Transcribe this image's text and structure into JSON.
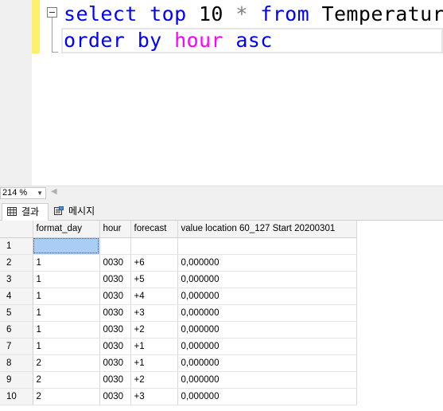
{
  "editor": {
    "lines": [
      [
        {
          "t": "select",
          "c": "kw"
        },
        {
          "t": " ",
          "c": "tx"
        },
        {
          "t": "top",
          "c": "kw"
        },
        {
          "t": " 10 ",
          "c": "tx"
        },
        {
          "t": "*",
          "c": "op"
        },
        {
          "t": " ",
          "c": "tx"
        },
        {
          "t": "from",
          "c": "kw"
        },
        {
          "t": " Temperature",
          "c": "tx"
        }
      ],
      [
        {
          "t": "order",
          "c": "kw"
        },
        {
          "t": " ",
          "c": "tx"
        },
        {
          "t": "by",
          "c": "kw"
        },
        {
          "t": " ",
          "c": "tx"
        },
        {
          "t": "hour",
          "c": "fn"
        },
        {
          "t": " ",
          "c": "tx"
        },
        {
          "t": "asc",
          "c": "kw"
        }
      ]
    ]
  },
  "zoom": {
    "value": "214 %"
  },
  "tabs": {
    "results": "결과",
    "messages": "메시지"
  },
  "grid": {
    "columns": [
      "format_day",
      "hour",
      "forecast",
      "value location 60_127 Start   20200301"
    ],
    "rows": [
      {
        "n": "1",
        "cells": [
          "",
          "",
          "",
          ""
        ]
      },
      {
        "n": "2",
        "cells": [
          "1",
          "0030",
          "+6",
          "0,000000"
        ]
      },
      {
        "n": "3",
        "cells": [
          "1",
          "0030",
          "+5",
          "0,000000"
        ]
      },
      {
        "n": "4",
        "cells": [
          "1",
          "0030",
          "+4",
          "0,000000"
        ]
      },
      {
        "n": "5",
        "cells": [
          "1",
          "0030",
          "+3",
          "0,000000"
        ]
      },
      {
        "n": "6",
        "cells": [
          "1",
          "0030",
          "+2",
          "0,000000"
        ]
      },
      {
        "n": "7",
        "cells": [
          "1",
          "0030",
          "+1",
          "0,000000"
        ]
      },
      {
        "n": "8",
        "cells": [
          "2",
          "0030",
          "+1",
          "0,000000"
        ]
      },
      {
        "n": "9",
        "cells": [
          "2",
          "0030",
          "+2",
          "0,000000"
        ]
      },
      {
        "n": "10",
        "cells": [
          "2",
          "0030",
          "+3",
          "0,000000"
        ]
      }
    ]
  },
  "colors": {
    "keyword": "#0000ff",
    "function": "#ff00ff",
    "operator": "#808080",
    "changebar": "#ffef6b",
    "selection": "#a9cdf5"
  }
}
